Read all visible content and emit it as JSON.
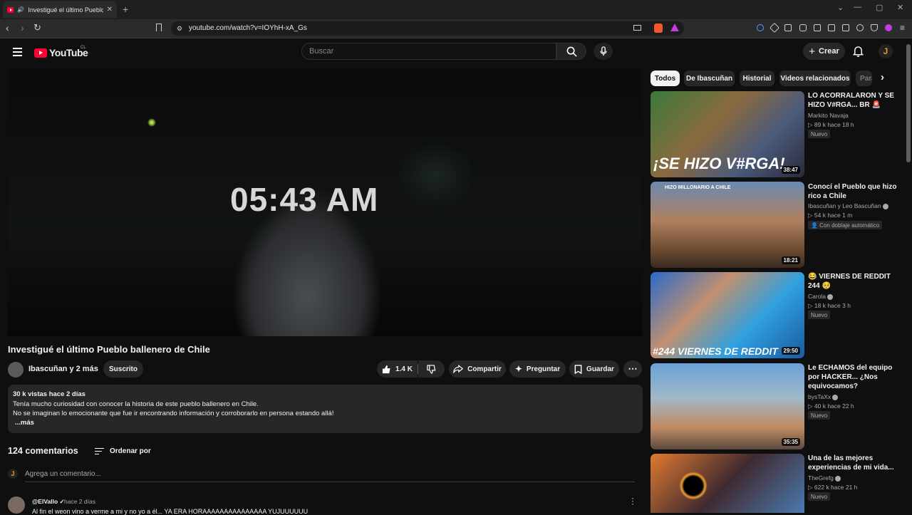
{
  "browser": {
    "tab_title": "Investigué el último Pueblo ballenero de Chile",
    "tab_close": "✕",
    "new_tab": "+",
    "url": "youtube.com/watch?v=IOYhH-xA_Gs",
    "window_controls": [
      "⌄",
      "—",
      "▢",
      "✕"
    ]
  },
  "header": {
    "logo_text": "YouTube",
    "region": "CL",
    "search_placeholder": "Buscar",
    "create_label": "Crear",
    "user_initial": "J"
  },
  "video": {
    "overlay_time": "05:43 AM",
    "title": "Investigué el último Pueblo ballenero de Chile",
    "channel": "Ibascuñan y 2 más",
    "subscribe_label": "Suscrito",
    "likes": "1.4 K",
    "share_label": "Compartir",
    "ask_label": "Preguntar",
    "save_label": "Guardar",
    "description": {
      "stats": "30 k vistas  hace 2 días",
      "line1": "Tenía mucho curiosidad con conocer la historia de este pueblo ballenero en Chile.",
      "line2": "No se imaginan lo emocionante que fue ir encontrando información y corroborarlo en persona estando allá!",
      "more": "...más"
    }
  },
  "comments": {
    "count_label": "124 comentarios",
    "sort_label": "Ordenar por",
    "add_placeholder": "Agrega un comentario...",
    "first": {
      "user": "@ElVallo ✓",
      "time": "hace 2 días",
      "text": "Al fin el weon vino a verme a mi y no yo a él... YA ERA HORAAAAAAAAAAAAAAA YUJUUUUUU"
    }
  },
  "chips": [
    "Todos",
    "De Ibascuñan",
    "Historial",
    "Videos relacionados",
    "Para"
  ],
  "related": [
    {
      "title": "LO ACORRALARON Y SE HIZO V#RGA... BR 🚨",
      "channel": "Markito Navaja",
      "verified": false,
      "meta": "▷ 89 k  hace 18 h",
      "badge": "Nuevo",
      "duration": "38:47",
      "thumb_text": "¡SE HIZO V#RGA!"
    },
    {
      "title": "Conocí el Pueblo que hizo rico a Chile",
      "channel": "Ibascuñan y Leo Bascuñan",
      "verified": true,
      "meta": "▷ 54 k  hace 1 m",
      "badge": "👤 Con doblaje automático",
      "duration": "18:21",
      "thumb_text": "HIZO MILLONARIO A CHILE"
    },
    {
      "title": "😂 VIERNES DE REDDIT 244 🥺",
      "channel": "Carola",
      "verified": true,
      "meta": "▷ 18 k  hace 3 h",
      "badge": "Nuevo",
      "duration": "29:50",
      "thumb_text": "#244  VIERNES DE REDDIT"
    },
    {
      "title": "Le ECHAMOS del equipo por HACKER... ¿Nos equivocamos?",
      "channel": "bysTaXx",
      "verified": true,
      "meta": "▷ 40 k  hace 22 h",
      "badge": "Nuevo",
      "duration": "35:35",
      "thumb_text": ""
    },
    {
      "title": "Una de las mejores experiencias de mi vida...",
      "channel": "TheGrefg",
      "verified": true,
      "meta": "▷ 622 k  hace 21 h",
      "badge": "Nuevo",
      "duration": "",
      "thumb_text": ""
    }
  ]
}
